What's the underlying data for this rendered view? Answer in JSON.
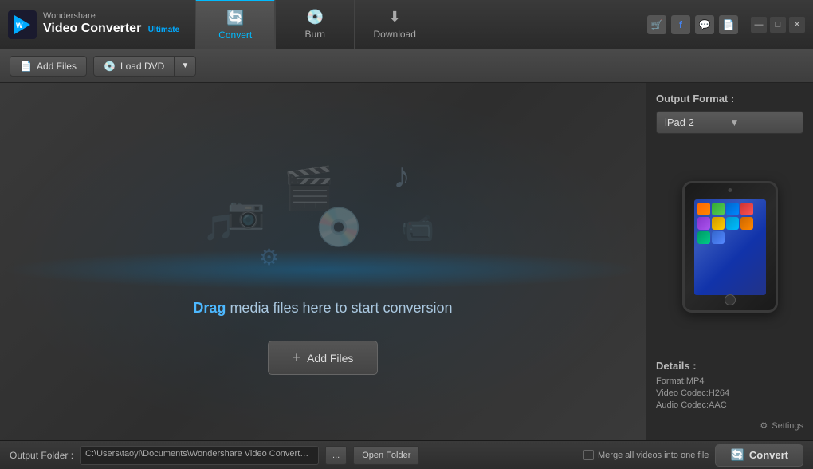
{
  "app": {
    "brand": "Wondershare",
    "product": "Video Converter",
    "edition": "Ultimate"
  },
  "tabs": [
    {
      "id": "convert",
      "label": "Convert",
      "icon": "🔄",
      "active": true
    },
    {
      "id": "burn",
      "label": "Burn",
      "icon": "💿",
      "active": false
    },
    {
      "id": "download",
      "label": "Download",
      "icon": "⬇",
      "active": false
    }
  ],
  "toolbar": {
    "add_files_label": "Add Files",
    "load_dvd_label": "Load DVD"
  },
  "dropzone": {
    "drag_prefix": "Drag",
    "drag_suffix": " media files here to start conversion",
    "add_files_label": "Add Files"
  },
  "right_panel": {
    "output_format_label": "Output Format :",
    "selected_format": "iPad 2",
    "details_label": "Details :",
    "format_line": "Format:MP4",
    "video_codec_line": "Video Codec:H264",
    "audio_codec_line": "Audio Codec:AAC",
    "settings_label": "Settings"
  },
  "status_bar": {
    "output_folder_label": "Output Folder :",
    "folder_path": "C:\\Users\\taoyi\\Documents\\Wondershare Video Converter Ultimate\\Outp...",
    "browse_label": "...",
    "open_folder_label": "Open Folder",
    "merge_label": "Merge all videos into one file",
    "convert_label": "Convert"
  },
  "window_controls": {
    "minimize": "—",
    "maximize": "□",
    "close": "✕"
  },
  "toolbar_icons": [
    {
      "name": "cart-icon",
      "symbol": "🛒"
    },
    {
      "name": "facebook-icon",
      "symbol": "f"
    },
    {
      "name": "chat-icon",
      "symbol": "💬"
    },
    {
      "name": "document-icon",
      "symbol": "📄"
    }
  ]
}
